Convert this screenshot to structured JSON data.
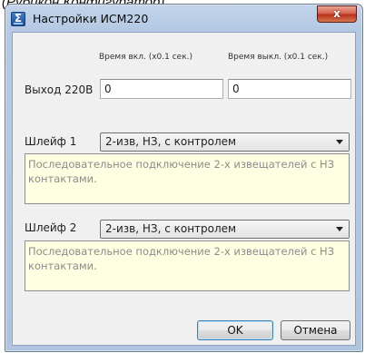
{
  "caption": "(Рубикон Конфигуратор)",
  "window": {
    "title": "Настройки ИСМ220",
    "close_symbol": "x",
    "icon": "app-logo-icon",
    "icon_glyph": "Σ"
  },
  "output": {
    "label": "Выход 220В",
    "on_time_header": "Время вкл. (x0.1 сек.)",
    "off_time_header": "Время выкл. (x0.1 сек.)",
    "on_time_value": "0",
    "off_time_value": "0"
  },
  "loop1": {
    "label": "Шлейф 1",
    "selected": "2-изв, НЗ, с контролем",
    "description": "Последовательное подключение 2-х извещателей с НЗ контактами."
  },
  "loop2": {
    "label": "Шлейф 2",
    "selected": "2-изв, НЗ, с контролем",
    "description": "Последовательное подключение 2-х извещателей с НЗ контактами."
  },
  "buttons": {
    "ok": "OK",
    "cancel": "Отмена"
  },
  "colors": {
    "note_bg": "#ffffe1",
    "close_button": "#c7432b",
    "frame": "#b4c9e3"
  }
}
